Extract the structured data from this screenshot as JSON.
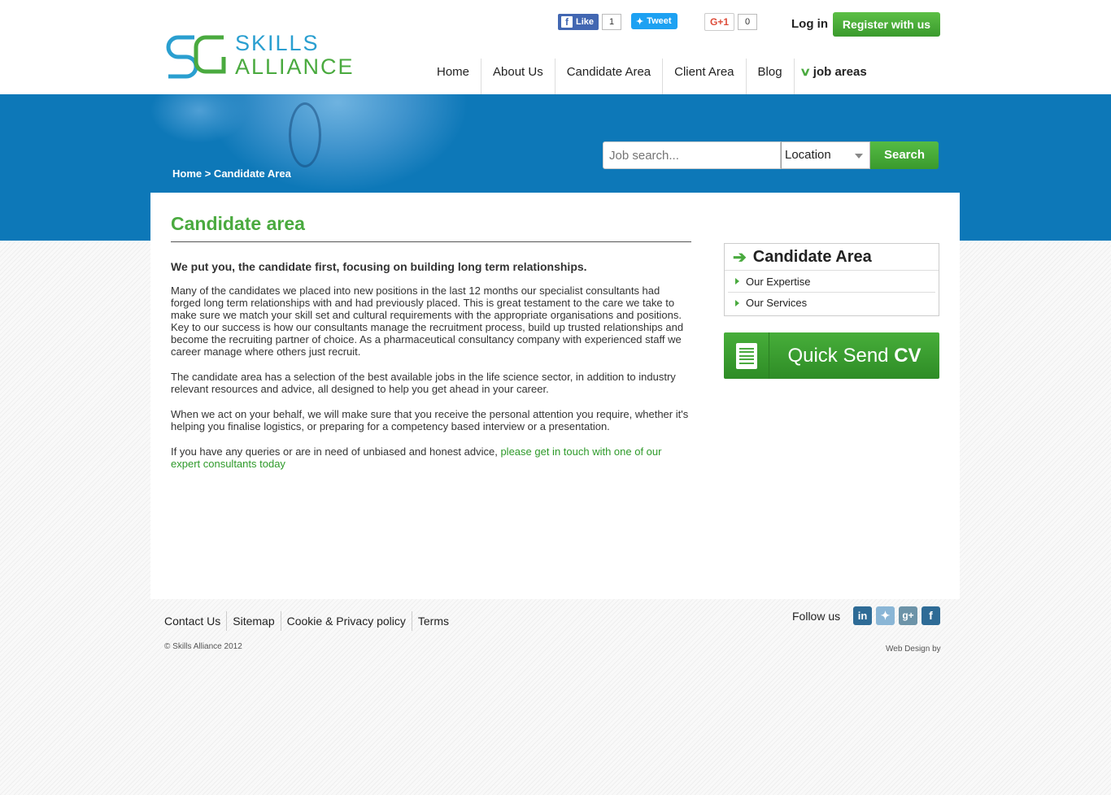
{
  "brand": {
    "line1": "SKILLS",
    "line2": "ALLIANCE",
    "brand_blue": "#2a9fd0",
    "brand_green": "#4aaa3f"
  },
  "social_buttons": {
    "facebook_like": "Like",
    "facebook_count": "1",
    "tweet": "Tweet",
    "gplus": "G+1",
    "gplus_count": "0"
  },
  "account": {
    "login": "Log in",
    "register": "Register with us"
  },
  "nav": {
    "items": [
      "Home",
      "About Us",
      "Candidate Area",
      "Client Area",
      "Blog"
    ],
    "job_areas": "job areas"
  },
  "banner": {
    "breadcrumb": "Home > Candidate Area",
    "search_placeholder": "Job search...",
    "location": "Location",
    "search_button": "Search",
    "color": "#0d78b8"
  },
  "main": {
    "title": "Candidate area",
    "lead": "We put you, the candidate first, focusing on building long term relationships.",
    "p1": "Many of the candidates we placed into new positions in the last 12 months our specialist consultants had forged long term relationships with and had previously placed. This is great testament to the care we take to make sure we match your skill set and cultural requirements with the appropriate organisations and positions. Key to our success is how our consultants manage the recruitment process, build up trusted relationships and become the recruiting partner of choice. As a pharmaceutical consultancy company with experienced staff we career manage where others just recruit.",
    "p2": "The candidate area has a selection of the best available jobs in the life science sector, in addition to industry relevant resources and advice, all designed to help you get ahead in your career.",
    "p3": "When we act on your behalf, we will make sure that you receive the personal attention you require, whether it's helping you finalise logistics, or preparing for a competency based interview or a presentation.",
    "p4_text": "If you have any queries or are in need of unbiased and honest advice, ",
    "p4_link": "please get in touch with one of our expert consultants today"
  },
  "sidebar": {
    "title": "Candidate Area",
    "items": [
      "Our Expertise",
      "Our Services"
    ],
    "quick_cv_light": "Quick Send",
    "quick_cv_bold": "CV"
  },
  "footer": {
    "links": [
      "Contact Us",
      "Sitemap",
      "Cookie & Privacy policy",
      "Terms"
    ],
    "copyright": "© Skills Alliance 2012",
    "follow": "Follow us",
    "web_design": "Web Design by",
    "icons": [
      "linkedin-icon",
      "twitter-icon",
      "google-plus-icon",
      "facebook-icon"
    ]
  }
}
